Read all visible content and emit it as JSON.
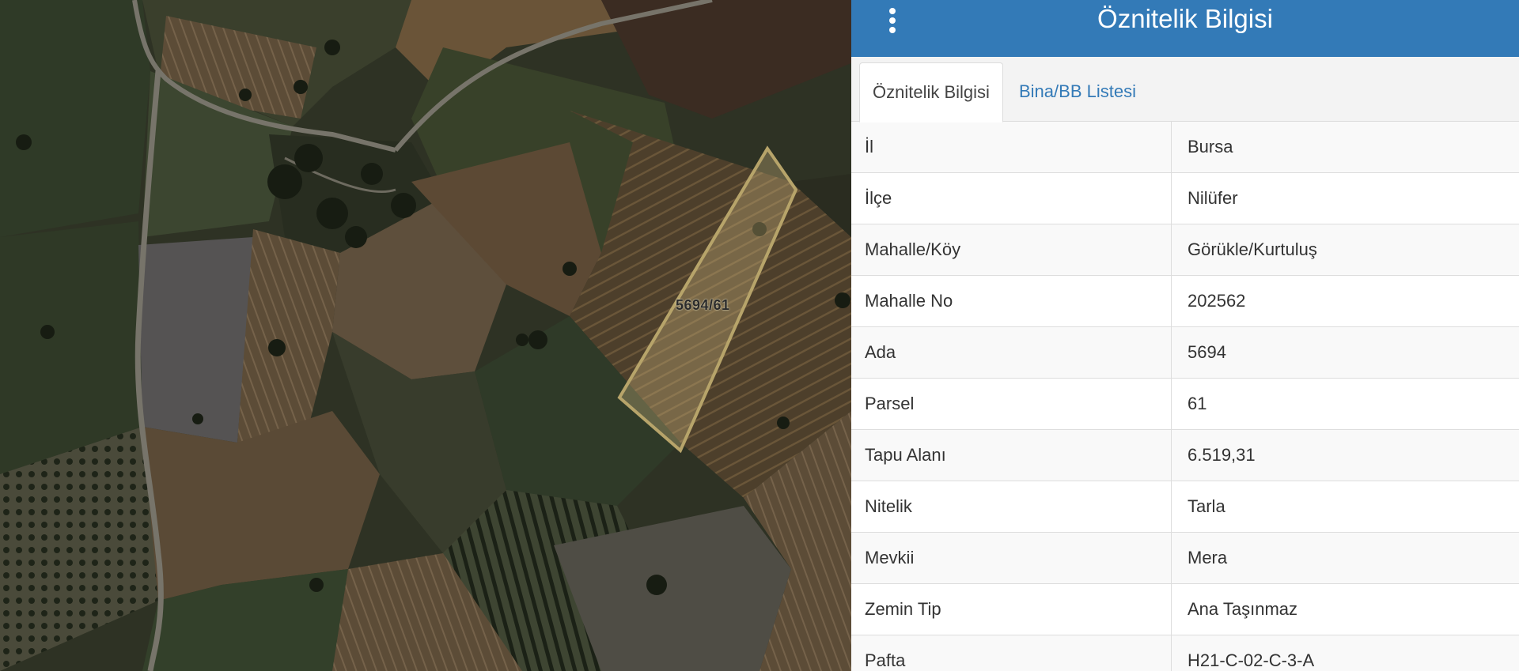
{
  "map": {
    "parcel_label": "5694/61"
  },
  "panel": {
    "title": "Öznitelik Bilgisi",
    "menu_icon": "vertical-ellipsis-icon",
    "tabs": [
      {
        "label": "Öznitelik Bilgisi",
        "active": true
      },
      {
        "label": "Bina/BB Listesi",
        "active": false
      }
    ],
    "rows": [
      {
        "key": "İl",
        "value": "Bursa"
      },
      {
        "key": "İlçe",
        "value": "Nilüfer"
      },
      {
        "key": "Mahalle/Köy",
        "value": "Görükle/Kurtuluş"
      },
      {
        "key": "Mahalle No",
        "value": "202562"
      },
      {
        "key": "Ada",
        "value": "5694"
      },
      {
        "key": "Parsel",
        "value": "61"
      },
      {
        "key": "Tapu Alanı",
        "value": "6.519,31"
      },
      {
        "key": "Nitelik",
        "value": "Tarla"
      },
      {
        "key": "Mevkii",
        "value": "Mera"
      },
      {
        "key": "Zemin Tip",
        "value": "Ana Taşınmaz"
      },
      {
        "key": "Pafta",
        "value": "H21-C-02-C-3-A"
      }
    ]
  },
  "colors": {
    "header_bg": "#337ab7",
    "tab_link": "#337ab7",
    "parcel_outline": "#b7a46a",
    "parcel_fill": "#c9b27a"
  }
}
